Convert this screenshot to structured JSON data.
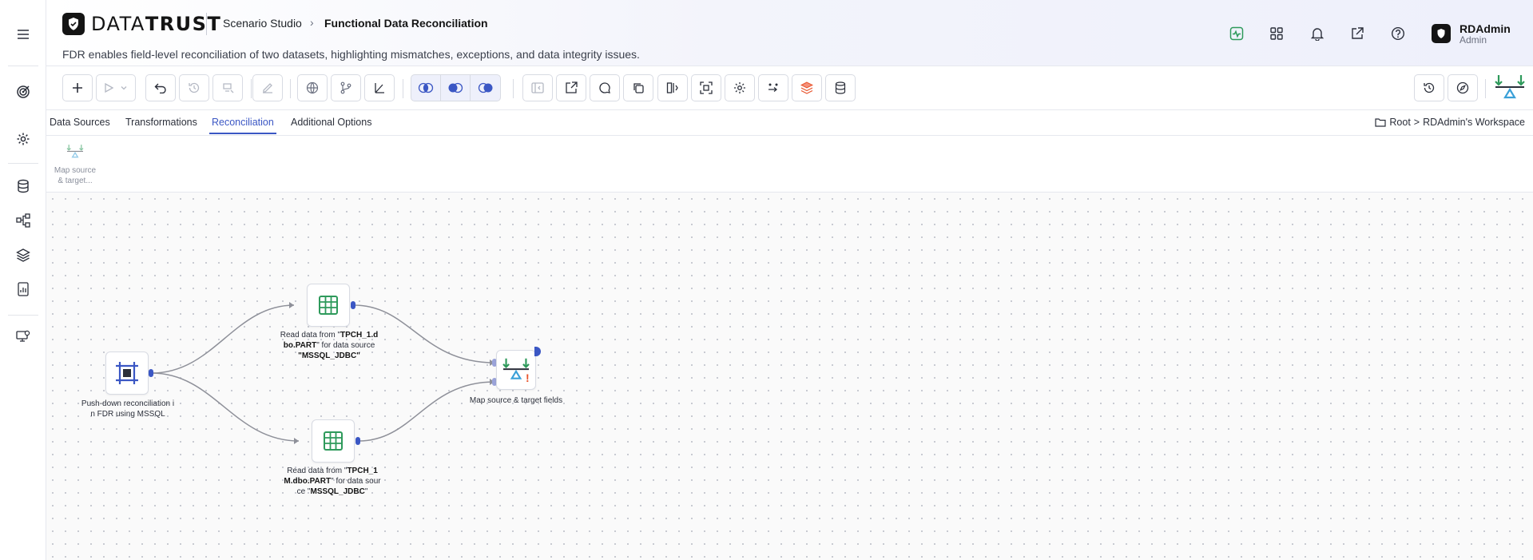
{
  "app": {
    "logo_main": "DATA",
    "logo_bold": "TRUST",
    "breadcrumb_parent": "Scenario Studio",
    "breadcrumb_current": "Functional Data Reconciliation",
    "subtitle": "FDR enables field-level reconciliation of two datasets, highlighting mismatches, exceptions, and data integrity issues."
  },
  "user": {
    "name": "RDAdmin",
    "role": "Admin"
  },
  "tabs": [
    {
      "label": "Data Sources",
      "active": false
    },
    {
      "label": "Transformations",
      "active": false
    },
    {
      "label": "Reconciliation",
      "active": true
    },
    {
      "label": "Additional Options",
      "active": false
    }
  ],
  "workspace": {
    "root": "Root",
    "sep": ">",
    "name": "RDAdmin's Workspace"
  },
  "palette": {
    "label_1": "Map source",
    "label_2": "& target..."
  },
  "nodes": {
    "pushdown": {
      "label_1": "Push-down reconciliation i",
      "label_2": "n FDR using MSSQL"
    },
    "read1": {
      "pre": "Read data from \"",
      "bold1": "TPCH_1.d",
      "bold2": "bo.PART",
      "mid": "\" for data source",
      "bold3": "\"MSSQL_JDBC\""
    },
    "read2": {
      "pre": "Read data from \"",
      "bold1": "TPCH_1",
      "bold2": "M.dbo.PART",
      "mid": "\" for data sour",
      "tail": "ce \"",
      "bold3": "MSSQL_JDBC",
      "end": "\""
    },
    "map": {
      "label": "Map source & target fields",
      "warning": "!"
    }
  },
  "colors": {
    "accent": "#3b57c4",
    "port": "#9aa3d9",
    "green": "#2e9a5b",
    "warning": "#e8532b"
  },
  "icons": {
    "rail": [
      "hamburger-icon",
      "target-icon",
      "gear-icon",
      "database-icon",
      "flow-icon",
      "layers-icon",
      "report-icon",
      "monitor-settings-icon"
    ],
    "header": [
      "activity-icon",
      "apps-grid-icon",
      "bell-icon",
      "external-link-icon",
      "help-icon"
    ]
  }
}
